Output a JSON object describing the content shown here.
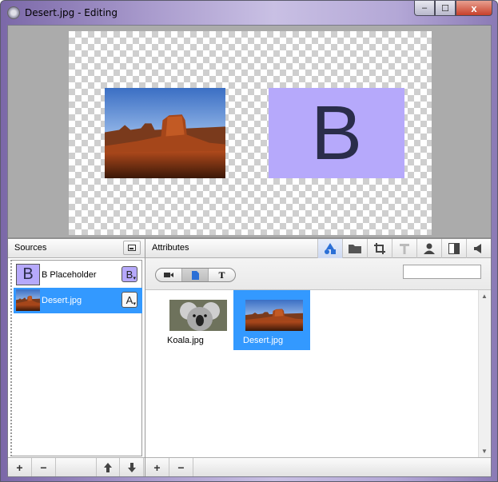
{
  "window": {
    "title": "Desert.jpg - Editing",
    "min_glyph": "–",
    "max_glyph": "☐",
    "close_glyph": "x"
  },
  "preview": {
    "placeholder_letter": "B"
  },
  "sources": {
    "header": "Sources",
    "items": [
      {
        "name": "B Placeholder",
        "thumb_letter": "B",
        "badge": "B",
        "selected": false
      },
      {
        "name": "Desert.jpg",
        "badge": "A",
        "selected": true
      }
    ],
    "bottom_buttons": [
      "+",
      "−",
      "🡅",
      "🡇"
    ]
  },
  "attributes": {
    "header": "Attributes",
    "tool_icons": [
      "shapes-icon",
      "folder-icon",
      "crop-icon",
      "text-icon",
      "person-icon",
      "panel-icon",
      "speaker-icon"
    ],
    "segment_text_glyph": "T",
    "search_placeholder": "",
    "tiles": [
      {
        "label": "Koala.jpg",
        "selected": false
      },
      {
        "label": "Desert.jpg",
        "selected": true
      }
    ],
    "bottom_buttons": [
      "+",
      "−"
    ]
  },
  "colors": {
    "selection": "#3399ff",
    "placeholder_bg": "#b6a9fb",
    "placeholder_fg": "#2a2d4a"
  }
}
